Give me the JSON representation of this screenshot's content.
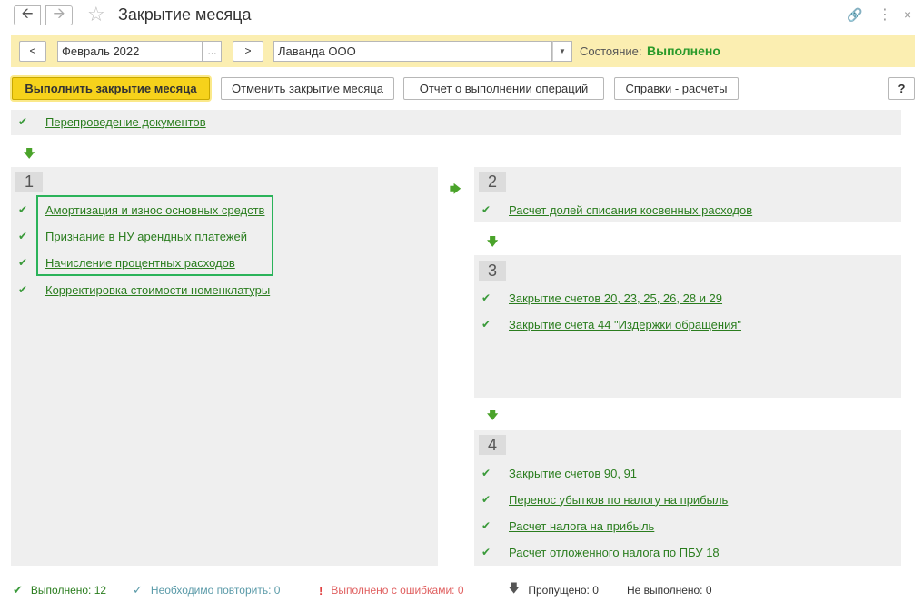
{
  "window": {
    "title": "Закрытие месяца"
  },
  "params": {
    "prev_label": "<",
    "period_value": "Февраль 2022",
    "period_select_label": "...",
    "next_label": ">",
    "organization_value": "Лаванда ООО",
    "state_label": "Состояние:",
    "state_value": "Выполнено"
  },
  "toolbar": {
    "run_label": "Выполнить закрытие месяца",
    "cancel_label": "Отменить закрытие месяца",
    "report_label": "Отчет о выполнении операций",
    "reference_label": "Справки - расчеты",
    "help_label": "?"
  },
  "top_item": {
    "label": "Перепроведение документов"
  },
  "stages": [
    {
      "number": "1",
      "items": [
        "Амортизация и износ основных средств",
        "Признание в НУ арендных платежей",
        "Начисление процентных расходов",
        "Корректировка стоимости номенклатуры"
      ]
    },
    {
      "number": "2",
      "items": [
        "Расчет долей списания косвенных расходов"
      ]
    },
    {
      "number": "3",
      "items": [
        "Закрытие счетов 20, 23, 25, 26, 28 и 29",
        "Закрытие счета 44 \"Издержки обращения\""
      ]
    },
    {
      "number": "4",
      "items": [
        "Закрытие счетов 90, 91",
        "Перенос убытков по налогу на прибыль",
        "Расчет налога на прибыль",
        "Расчет отложенного налога по ПБУ 18"
      ]
    }
  ],
  "status": {
    "done_label": "Выполнено:",
    "done_count": "12",
    "repeat_label": "Необходимо повторить:",
    "repeat_count": "0",
    "errors_label": "Выполнено с ошибками:",
    "errors_count": "0",
    "skipped_label": "Пропущено:",
    "skipped_count": "0",
    "not_done_label": "Не выполнено:",
    "not_done_count": "0"
  },
  "colors": {
    "accent_yellow": "#f6d21b",
    "params_bg": "#fbeeb1",
    "link_green": "#2a7d1e",
    "state_green": "#2a9a2a",
    "highlight_border": "#2bb35a",
    "error_red": "#e06060",
    "repeat_teal": "#5a9aa8"
  }
}
